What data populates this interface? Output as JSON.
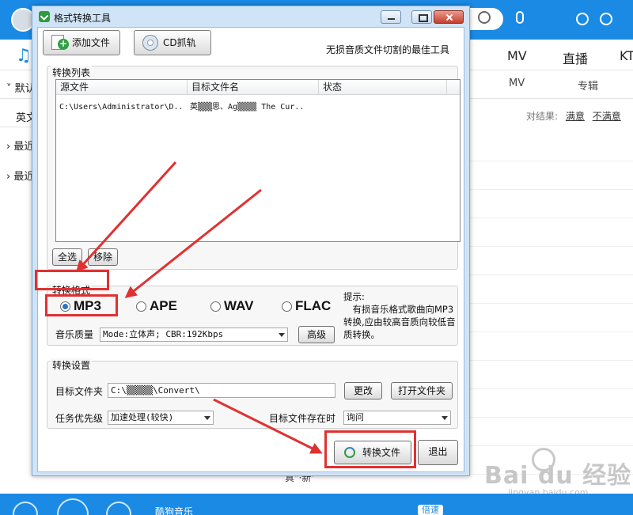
{
  "background": {
    "nav": [
      "MV",
      "直播",
      "KT"
    ],
    "subnav": [
      "MV",
      "专辑"
    ],
    "side_items": [
      "默认",
      "英文",
      "最近",
      "最近"
    ],
    "feedback_label": "对结果:",
    "feedback_yes": "满意",
    "feedback_no": "不满意",
    "bottom_title": "酷狗音乐",
    "speed_label": "倍速",
    "row_partial_text": "真\"·新'",
    "watermark": "Bai du 经验",
    "watermark_url": "jingyan.baidu.com"
  },
  "dialog": {
    "title": "格式转换工具",
    "toolbar": {
      "add_file_label": "添加文件",
      "cd_rip_label": "CD抓轨",
      "slogan": "无损音质文件切割的最佳工具"
    },
    "list_section": {
      "label": "转换列表",
      "columns": [
        "源文件",
        "目标文件名",
        "状态"
      ],
      "rows": [
        {
          "source": "C:\\Users\\Administrator\\D..",
          "target": "英▒▒▒思、Ag▒▒▒▒ The Cur..",
          "status": ""
        }
      ],
      "select_all_label": "全选",
      "remove_label": "移除"
    },
    "format_section": {
      "label": "转换格式",
      "formats": [
        "MP3",
        "APE",
        "WAV",
        "FLAC"
      ],
      "selected": "MP3",
      "quality_label": "音乐质量",
      "quality_value": "Mode:立体声; CBR:192Kbps",
      "advanced_label": "高级",
      "hint": "提示:\n　有损音乐格式歌曲向MP3转换,应由较高音质向较低音质转换。"
    },
    "settings_section": {
      "label": "转换设置",
      "target_folder_label": "目标文件夹",
      "target_folder_value": "C:\\▒▒▒▒▒\\Convert\\",
      "change_label": "更改",
      "open_folder_label": "打开文件夹",
      "priority_label": "任务优先级",
      "priority_value": "加速处理(较快)",
      "exists_label": "目标文件存在时",
      "exists_value": "询问"
    },
    "convert_label": "转换文件",
    "exit_label": "退出"
  },
  "colors": {
    "accent": "#1a8ae5",
    "annotation": "#e03131",
    "dialog_frame": "#cfe4f7"
  }
}
